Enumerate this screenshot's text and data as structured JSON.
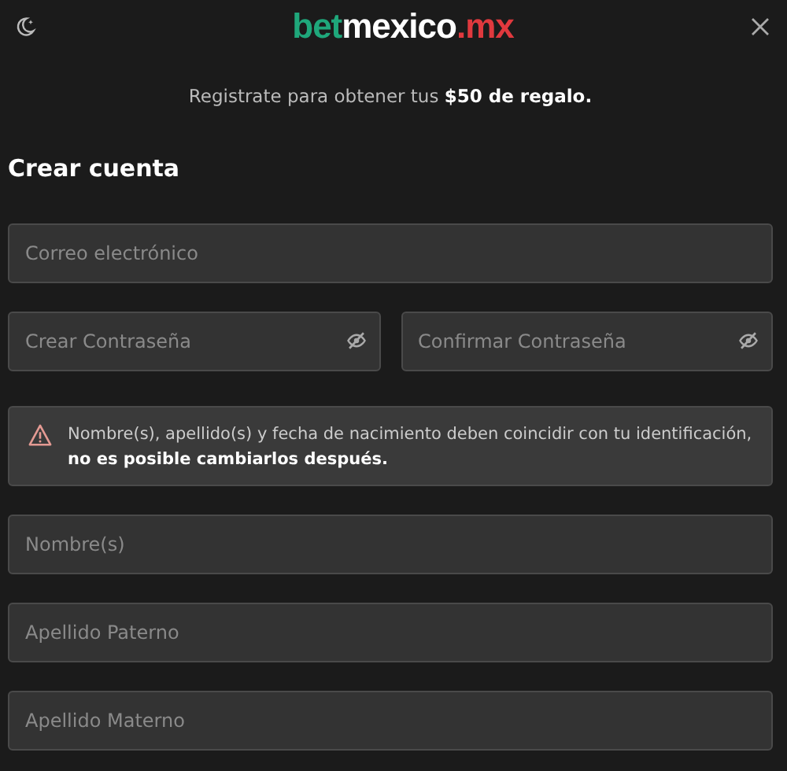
{
  "logo": [
    {
      "text": "bet",
      "color": "#1fa77b"
    },
    {
      "text": "mexico",
      "color": "#ffffff"
    },
    {
      "text": ".mx",
      "color": "#e0393e"
    }
  ],
  "subtitle": "Registrate para obtener tus **$50 de regalo.**",
  "heading": "Crear cuenta",
  "email": {
    "placeholder": "Correo electrónico"
  },
  "passwords": [
    {
      "placeholder": "Crear Contraseña"
    },
    {
      "placeholder": "Confirmar Contraseña"
    }
  ],
  "notice": "Nombre(s), apellido(s) y fecha de nacimiento deben coincidir con tu identificación, **no es posible cambiarlos después.**",
  "name_fields": [
    {
      "placeholder": "Nombre(s)"
    },
    {
      "placeholder": "Apellido Paterno"
    },
    {
      "placeholder": "Apellido Materno"
    }
  ]
}
